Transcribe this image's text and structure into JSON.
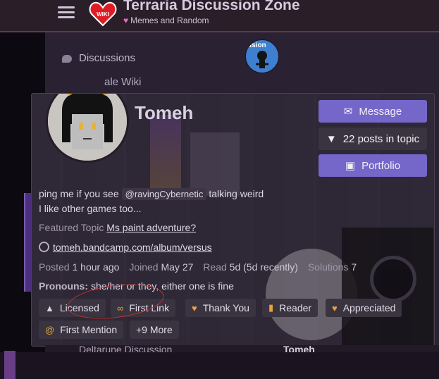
{
  "site": {
    "title": "Terraria Discussion Zone",
    "subtitle": "Memes and Random",
    "logo_text": "WIKI"
  },
  "nav": {
    "discussions_label": "Discussions",
    "wiki_label": "ale Wiki"
  },
  "top_avatar_text": "usion",
  "profile": {
    "name": "Tomeh",
    "buttons": {
      "message": "Message",
      "posts_in_topic": "22 posts in topic",
      "portfolio": "Portfolio"
    },
    "bio_line1_before": "ping me if you see",
    "bio_mention": "@ravingCybernetic",
    "bio_line1_after": "talking weird",
    "bio_line2": "I like other games too...",
    "featured_label": "Featured Topic",
    "featured_topic": "Ms paint adventure?",
    "website": "tomeh.bandcamp.com/album/versus",
    "stats": {
      "posted_label": "Posted",
      "posted_value": "1 hour ago",
      "joined_label": "Joined",
      "joined_value": "May 27",
      "read_label": "Read",
      "read_value": "5d (5d recently)",
      "solutions_label": "Solutions",
      "solutions_value": "7"
    },
    "pronouns_label": "Pronouns:",
    "pronouns_value": "she/her or they, either one is fine",
    "badges": [
      {
        "label": "Licensed",
        "icon": "certificate-icon"
      },
      {
        "label": "First Link",
        "icon": "link-icon"
      },
      {
        "label": "Thank You",
        "icon": "heart-icon"
      },
      {
        "label": "Reader",
        "icon": "book-icon"
      },
      {
        "label": "Appreciated",
        "icon": "heart-icon"
      },
      {
        "label": "First Mention",
        "icon": "at-icon"
      },
      {
        "label": "+9 More",
        "icon": ""
      }
    ]
  },
  "bottom": {
    "topic": "Deltarune Discussion",
    "author": "Tomeh"
  },
  "colors": {
    "accent": "#7566c9",
    "badge_icon": "#e6a33a",
    "annotation_circle": "#c0302e"
  }
}
